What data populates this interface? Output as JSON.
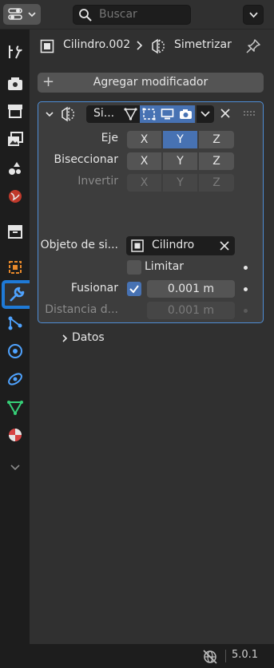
{
  "header": {
    "editor_type_icon": "properties-editor-icon",
    "search_placeholder": "Buscar",
    "search_icon": "search-icon"
  },
  "tabs": [
    {
      "name": "tool",
      "icon": "tool-icon"
    },
    {
      "name": "render",
      "icon": "render-icon"
    },
    {
      "name": "output",
      "icon": "output-icon"
    },
    {
      "name": "view-layer",
      "icon": "view-layer-icon"
    },
    {
      "name": "scene",
      "icon": "scene-icon"
    },
    {
      "name": "world",
      "icon": "world-icon"
    },
    {
      "name": "collection",
      "icon": "collection-icon"
    },
    {
      "name": "object",
      "icon": "object-icon"
    },
    {
      "name": "modifiers",
      "icon": "wrench-icon",
      "active": true
    },
    {
      "name": "particles",
      "icon": "particles-icon"
    },
    {
      "name": "physics",
      "icon": "physics-icon"
    },
    {
      "name": "constraints",
      "icon": "constraints-icon"
    },
    {
      "name": "data",
      "icon": "mesh-data-icon"
    },
    {
      "name": "material",
      "icon": "material-icon"
    },
    {
      "name": "more",
      "icon": "chevron-down-icon"
    }
  ],
  "breadcrumb": {
    "object": "Cilindro.002",
    "modifier": "Simetrizar"
  },
  "add_modifier_label": "Agregar modificador",
  "modifier": {
    "name": "Si...",
    "axis_label": "Eje",
    "bisect_label": "Biseccionar",
    "flip_label": "Invertir",
    "axes": [
      "X",
      "Y",
      "Z"
    ],
    "axis_selected": "Y",
    "mirror_object_label": "Objeto de si...",
    "mirror_object_value": "Cilindro",
    "clipping_label": "Limitar",
    "merge_label": "Fusionar",
    "merge_value": "0.001 m",
    "merge_checked": true,
    "bisect_distance_label": "Distancia d...",
    "bisect_distance_value": "0.001 m",
    "data_subpanel_label": "Datos"
  },
  "colors": {
    "accent": "#4772b3",
    "active_tab_outline": "#1f7ad6",
    "panel_outline": "#4f8ed6"
  },
  "status": {
    "version": "5.0.1"
  }
}
